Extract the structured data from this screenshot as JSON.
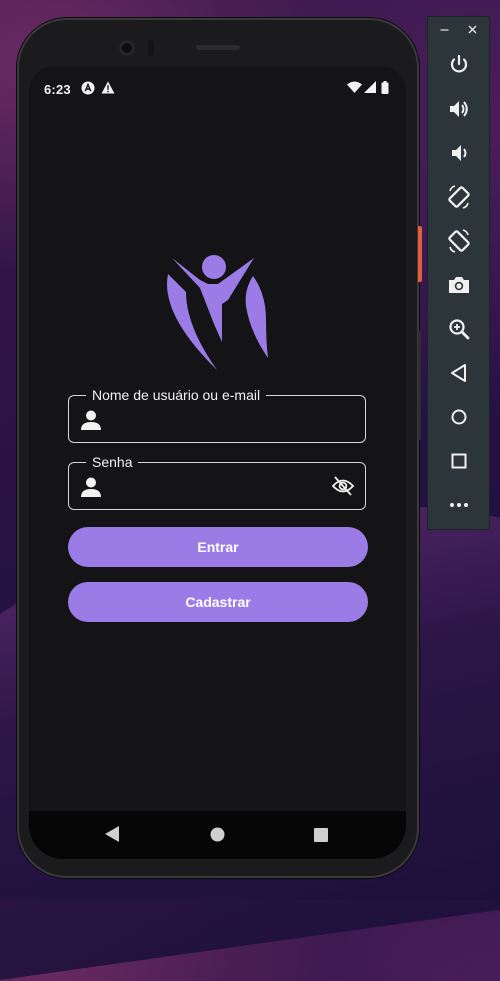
{
  "status_bar": {
    "time": "6:23",
    "left_icons": [
      "app-a-icon",
      "warning-icon"
    ],
    "right_icons": [
      "wifi-icon",
      "signal-icon",
      "battery-icon"
    ]
  },
  "login": {
    "username_label": "Nome de usuário ou e-mail",
    "username_value": "",
    "password_label": "Senha",
    "password_value": "",
    "login_button": "Entrar",
    "register_button": "Cadastrar"
  },
  "nav_bar": [
    "back-icon",
    "home-icon",
    "recents-icon"
  ],
  "emulator_toolbar": {
    "window_controls": [
      "minimize-icon",
      "close-icon"
    ],
    "tools": [
      "power-icon",
      "volume-up-icon",
      "volume-down-icon",
      "rotate-left-icon",
      "rotate-right-icon",
      "camera-icon",
      "zoom-icon",
      "back-icon",
      "home-icon",
      "overview-icon",
      "more-icon"
    ]
  },
  "colors": {
    "accent": "#9b7ce6",
    "screen_background": "#141416",
    "field_border": "#d7d7d9",
    "text": "#f2f2f2"
  }
}
